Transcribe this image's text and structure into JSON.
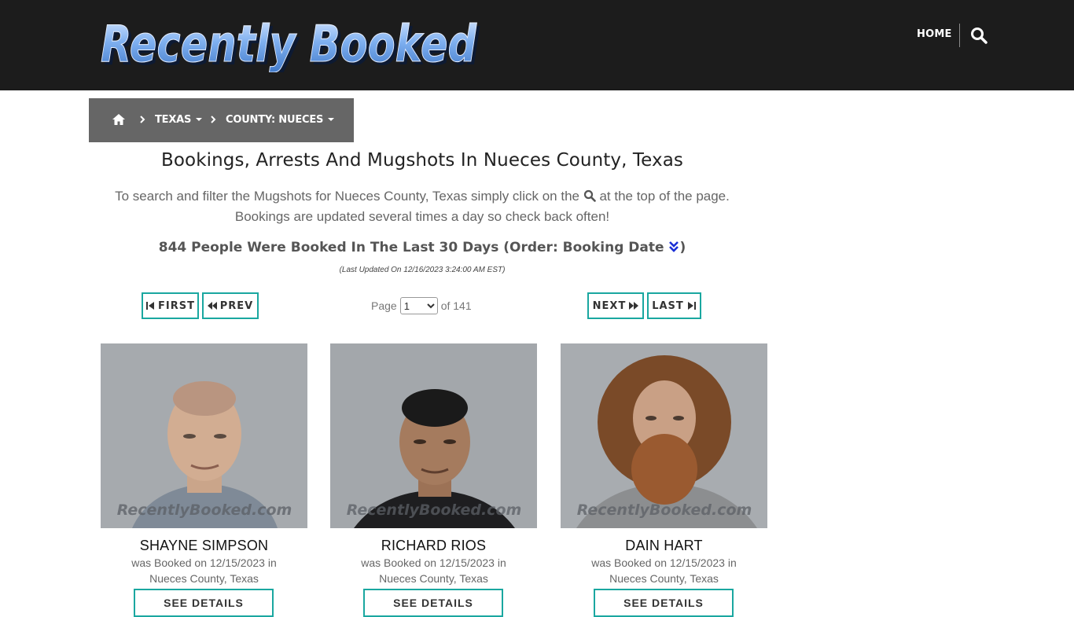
{
  "header": {
    "logo_text": "Recently Booked",
    "nav_home": "HOME",
    "search_icon": "search-icon"
  },
  "breadcrumb": {
    "home_icon": "home-icon",
    "state": "TEXAS",
    "county": "COUNTY: NUECES"
  },
  "page": {
    "title": "Bookings, Arrests And Mugshots In Nueces County, Texas",
    "intro_before": "To search and filter the Mugshots for Nueces County, Texas simply click on the",
    "intro_after": "at the top of the page. Bookings are updated several times a day so check back often!",
    "count_text": "844 People Were Booked In The Last 30 Days (Order: Booking Date ",
    "count_close": ")",
    "last_updated": "(Last Updated On 12/16/2023 3:24:00 AM EST)"
  },
  "pagination": {
    "first": "FIRST",
    "prev": "PREV",
    "next": "NEXT",
    "last": "LAST",
    "page_label": "Page",
    "current_page": "1",
    "of_label": "of 141"
  },
  "cards": [
    {
      "name": "SHAYNE SIMPSON",
      "line1": "was Booked on 12/15/2023 in",
      "line2": "Nueces County, Texas",
      "watermark": "RecentlyBooked.com",
      "button": "SEE DETAILS"
    },
    {
      "name": "RICHARD RIOS",
      "line1": "was Booked on 12/15/2023 in",
      "line2": "Nueces County, Texas",
      "watermark": "RecentlyBooked.com",
      "button": "SEE DETAILS"
    },
    {
      "name": "DAIN HART",
      "line1": "was Booked on 12/15/2023 in",
      "line2": "Nueces County, Texas",
      "watermark": "RecentlyBooked.com",
      "button": "SEE DETAILS"
    }
  ],
  "colors": {
    "header_bg": "#1c1c1c",
    "breadcrumb_bg": "#666666",
    "button_border": "#1aa7a0",
    "logo_blue": "#6fa2e8"
  }
}
